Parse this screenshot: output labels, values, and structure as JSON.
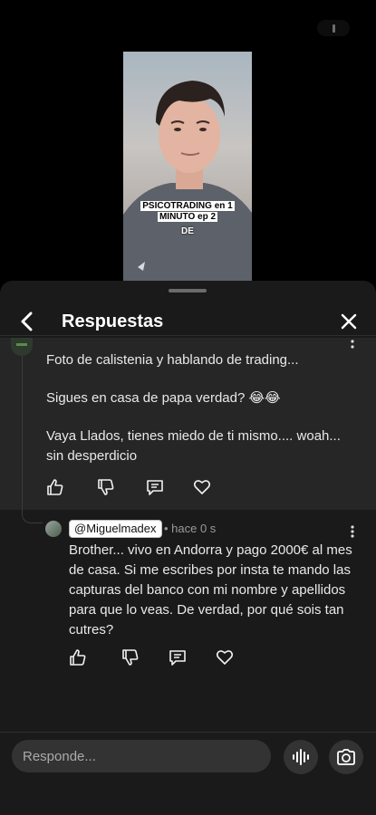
{
  "video": {
    "caption_line1": "PSICOTRADING en 1",
    "caption_line2": "MINUTO ep 2",
    "caption_word": "DE"
  },
  "panel": {
    "title": "Respuestas",
    "back_icon": "chevron-left-icon",
    "close_icon": "close-icon"
  },
  "parent_comment": {
    "paragraphs": [
      "Foto de calistenia y hablando de trading...",
      "Sigues en casa de papa verdad? 😂😂",
      "Vaya Llados, tienes miedo de ti mismo.... woah... sin desperdicio"
    ]
  },
  "reply": {
    "username": "@Miguelmadex",
    "time": "• hace 0 s",
    "text": "Brother... vivo en Andorra y pago 2000€ al mes de casa. Si me escribes por insta te mando las capturas del banco con mi nombre y apellidos para que lo veas. De verdad, por qué sois tan cutres?"
  },
  "composer": {
    "placeholder": "Responde...",
    "voice_icon": "voice-icon",
    "camera_icon": "camera-icon"
  },
  "colors": {
    "panel_bg": "#1a1a1a",
    "highlight_bg": "#262626",
    "text": "#e9e9e9",
    "muted": "#9a9a9a"
  }
}
